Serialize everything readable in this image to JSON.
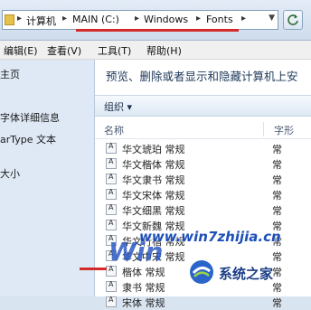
{
  "address": {
    "crumbs": [
      "计算机",
      "MAIN (C:)",
      "Windows",
      "Fonts"
    ]
  },
  "menubar": {
    "items": [
      "编辑(E)",
      "查看(V)",
      "工具(T)",
      "帮助(H)"
    ]
  },
  "nav": {
    "items": [
      "主页",
      "",
      "字体详细信息",
      "arType 文本",
      "",
      "大小"
    ]
  },
  "main": {
    "heading": "预览、删除或者显示和隐藏计算机上安",
    "organize_label": "组织 ▾",
    "col_name": "名称",
    "col_type": "字形",
    "rows": [
      {
        "name": "华文琥珀 常规",
        "type": "常"
      },
      {
        "name": "华文楷体 常规",
        "type": "常"
      },
      {
        "name": "华文隶书 常规",
        "type": "常"
      },
      {
        "name": "华文宋体 常规",
        "type": "常"
      },
      {
        "name": "华文细黑 常规",
        "type": "常"
      },
      {
        "name": "华文新魏 常规",
        "type": "常"
      },
      {
        "name": "华文行楷 常规",
        "type": "常"
      },
      {
        "name": "华文中宋 常规",
        "type": "常"
      },
      {
        "name": "楷体 常规",
        "type": "常"
      },
      {
        "name": "隶书 常规",
        "type": "常"
      },
      {
        "name": "宋体 常规",
        "type": "常"
      }
    ]
  },
  "watermark": {
    "url": "www.win7zhijia.cn",
    "title": "系统之家",
    "win": "Win"
  },
  "colors": {
    "accent_red": "#d42a2a",
    "watermark_blue": "#1d4fb8",
    "nav_bg": "#dfe9f5"
  }
}
